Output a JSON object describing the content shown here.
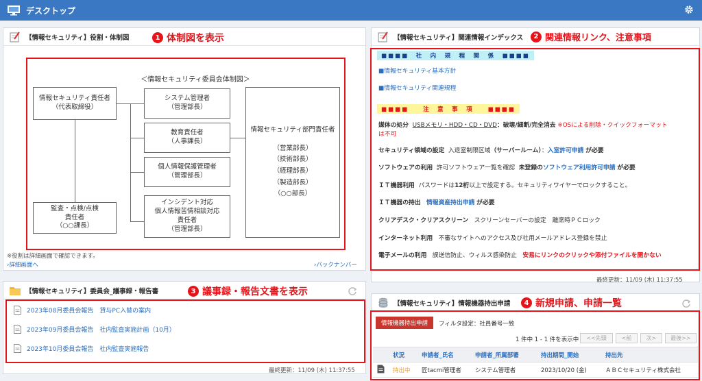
{
  "topbar": {
    "title": "デスクトップ"
  },
  "org_panel": {
    "title": "【情報セキュリティ】役割・体制図",
    "annotation_num": "1",
    "annotation": "体制図を表示",
    "chart_caption": "＜情報セキュリティ委員会体制図＞",
    "boxes": {
      "chief": [
        "情報セキュリティ責任者",
        "（代表取締役）"
      ],
      "audit": [
        "監査・点検/点検",
        "責任者",
        "（○○課長）"
      ],
      "sys": [
        "システム管理者",
        "（管理部長）"
      ],
      "edu": [
        "教育責任者",
        "（人事課長）"
      ],
      "privacy": [
        "個人情報保護管理者",
        "（管理部長）"
      ],
      "incident": [
        "インシデント対応",
        "個人情報苦情相談対応",
        "責任者",
        "（管理部長）"
      ],
      "dept": [
        "情報セキュリティ部門責任者",
        "（営業部長）",
        "（技術部長）",
        "（経理部長）",
        "（製造部長）",
        "（○○部長）"
      ]
    },
    "note": "※役割は詳細画面で確認できます。",
    "detail_link": "詳細画面へ",
    "backnumber_link": "バックナンバー"
  },
  "index_panel": {
    "title": "【情報セキュリティ】関連情報インデックス",
    "annotation_num": "2",
    "annotation": "関連情報リンク、注意事項",
    "rules_header": "■■■■　社　内　規　程　関　係　■■■■",
    "link1": "■情報セキュリティ基本方針",
    "link2": "■情報セキュリティ関連規程",
    "caution_header": "■■■■　　注　意　事　項　　■■■■",
    "r1_label": "媒体の処分",
    "r1_media": "USBメモリ・HDD・CD・DVD",
    "r1_rule": "：破壊/細断/完全消去",
    "r1_warn": "※OSによる削除・クイックフォーマット",
    "r1_warn2": "は不可",
    "r2_label": "セキュリティ領域の設定",
    "r2_text": "入退室制限区域",
    "r2_area": "（サーバールーム）",
    "r2_colon": "：",
    "r2_link": "入室許可申請",
    "r2_tail": "が必要",
    "r3_label": "ソフトウェアの利用",
    "r3_text": "許可ソフトウェア一覧を確認",
    "r3_bold": "未登録の",
    "r3_link": "ソフトウェア利用許可申請",
    "r3_tail": "が必要",
    "r4_label": "ＩＴ機器利用",
    "r4_text": "パスワードは",
    "r4_bold": "12桁",
    "r4_text2": "以上で設定する。セキュリティワイヤーでロックすること。",
    "r5_label": "ＩＴ機器の持出",
    "r5_link": "情報資産持出申請",
    "r5_tail": "が必要",
    "r6_label": "クリアデスク・クリアスクリーン",
    "r6_text": "スクリーンセーバーの設定　離席時ＰＣロック",
    "r7_label": "インターネット利用",
    "r7_text": "不審なサイトへのアクセス及び社用メールアドレス登録を禁止",
    "r8_label": "電子メールの利用",
    "r8_text": "誤送信防止、ウィルス感染防止",
    "r8_warn": "安易にリンクのクリックや添付ファイルを開かない",
    "updated": "最終更新：11/09 (木) 11:37:55"
  },
  "minutes_panel": {
    "title": "【情報セキュリティ】委員会_議事録・報告書",
    "annotation_num": "3",
    "annotation": "議事録・報告文書を表示",
    "items": [
      "2023年08月委員会報告　貸与PC入替の案内",
      "2023年09月委員会報告　社内監査実施計画（10月）",
      "2023年10月委員会報告　社内監査実施報告"
    ],
    "updated": "最終更新：11/09 (木) 11:37:55"
  },
  "device_panel": {
    "title": "【情報セキュリティ】情報機器持出申請",
    "annotation_num": "4",
    "annotation": "新規申請、申請一覧",
    "tab": "情報機器持出申請",
    "filter": "フィルタ設定：社員番号一致",
    "count": "1 件中 1 - 1 件を表示中",
    "pager": [
      "<<先頭",
      "<前",
      "次>",
      "最後>>"
    ],
    "columns": [
      "状況",
      "申請者_氏名",
      "申請者_所属部署",
      "持出期間_開始",
      "持出先"
    ],
    "rows": [
      [
        "持出中",
        "匠tacmi管理者",
        "システム管理者",
        "2023/10/20 (金)",
        "ＡＢＣセキュリティ株式会社"
      ]
    ]
  },
  "colors": {
    "topbar": "#3a78c3",
    "annotation_red": "#e5141b",
    "link_blue": "#2c6fbf",
    "tab_red": "#c8362d",
    "status_orange": "#e8a23a"
  }
}
